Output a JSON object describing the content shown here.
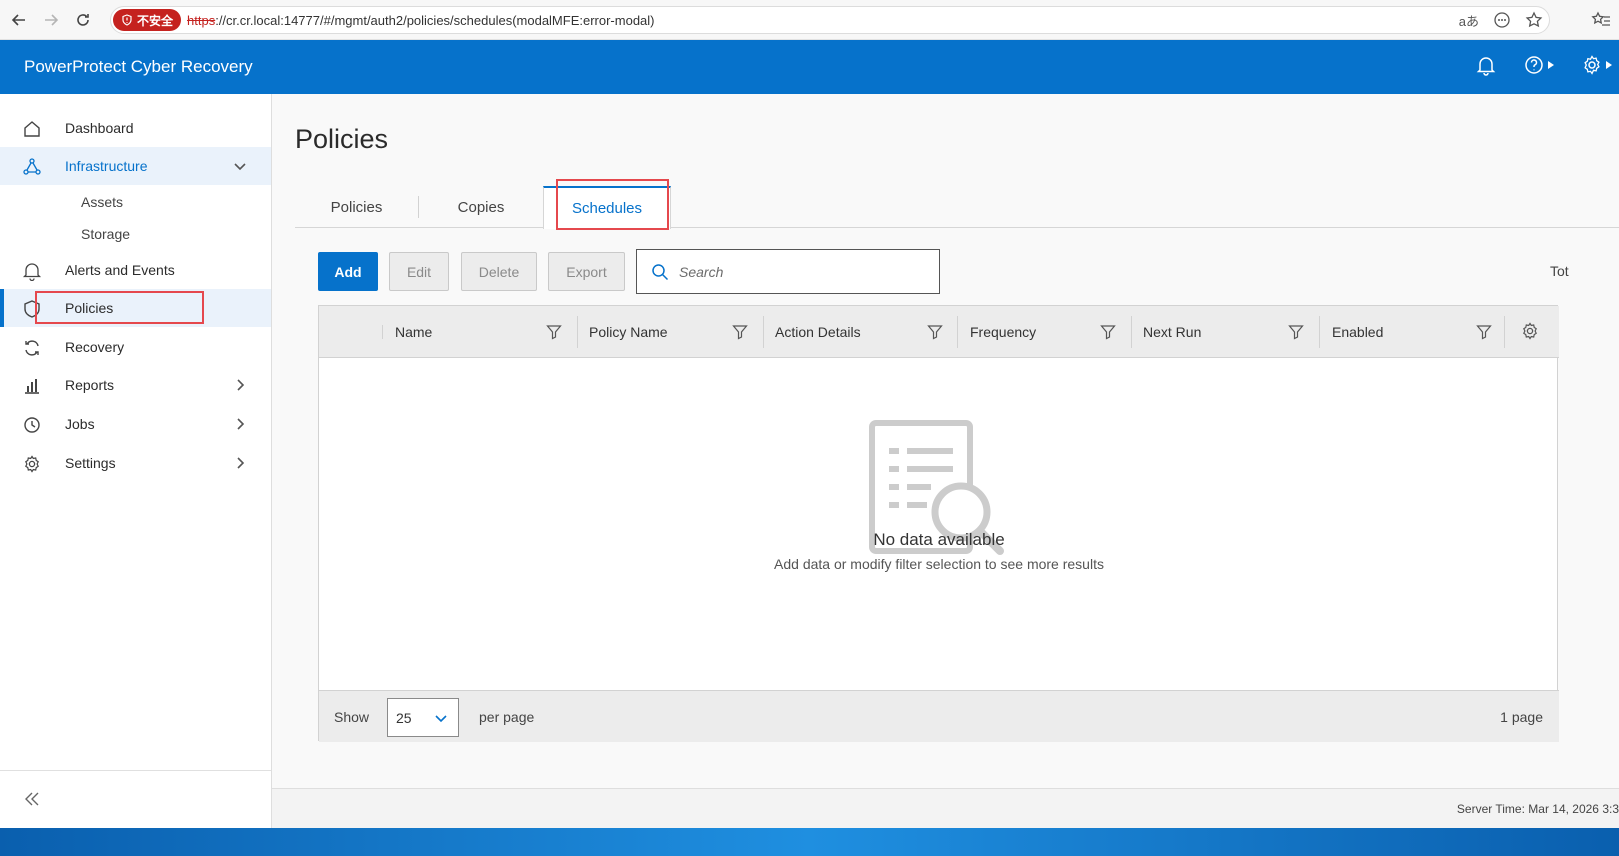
{
  "browser": {
    "insecure_label": "不安全",
    "url_scheme": "https",
    "url_rest": "://cr.cr.local:14777/#/mgmt/auth2/policies/schedules(modalMFE:error-modal)"
  },
  "app": {
    "title": "PowerProtect Cyber Recovery",
    "brand_color": "#0672cb"
  },
  "sidebar": {
    "items": [
      {
        "label": "Dashboard",
        "icon": "home-icon"
      },
      {
        "label": "Infrastructure",
        "icon": "network-icon",
        "expanded": true
      },
      {
        "label": "Alerts and Events",
        "icon": "bell-icon"
      },
      {
        "label": "Policies",
        "icon": "shield-icon",
        "active": true
      },
      {
        "label": "Recovery",
        "icon": "refresh-icon"
      },
      {
        "label": "Reports",
        "icon": "bar-chart-icon"
      },
      {
        "label": "Jobs",
        "icon": "clock-icon"
      },
      {
        "label": "Settings",
        "icon": "gear-icon"
      }
    ],
    "sub_items": [
      "Assets",
      "Storage"
    ]
  },
  "page": {
    "title": "Policies",
    "tabs": [
      {
        "label": "Policies"
      },
      {
        "label": "Copies"
      },
      {
        "label": "Schedules",
        "active": true
      }
    ]
  },
  "toolbar": {
    "add": "Add",
    "edit": "Edit",
    "delete": "Delete",
    "export": "Export",
    "search_placeholder": "Search",
    "total_partial": "Tot"
  },
  "table": {
    "columns": [
      "Name",
      "Policy Name",
      "Action Details",
      "Frequency",
      "Next Run",
      "Enabled"
    ],
    "empty_title": "No data available",
    "empty_subtitle": "Add data or modify filter selection to see more results",
    "footer": {
      "show": "Show",
      "page_size": "25",
      "per_page": "per page",
      "page_count": "1 page"
    }
  },
  "status": {
    "server_time": "Server Time:  Mar 14, 2026 3:3"
  }
}
